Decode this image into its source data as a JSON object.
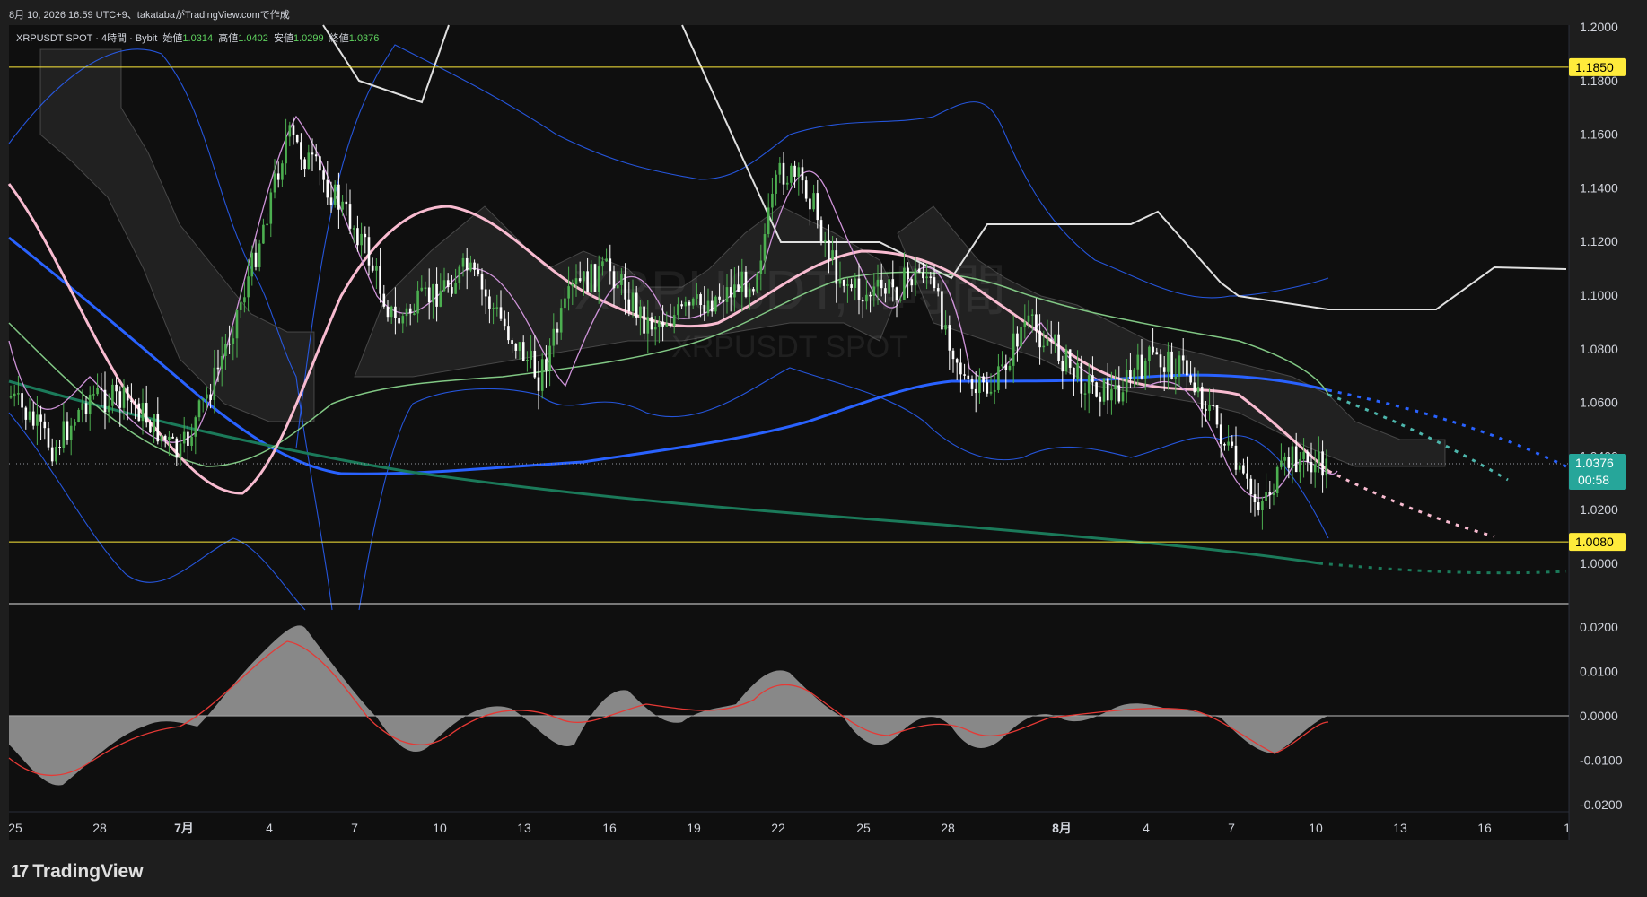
{
  "header": {
    "timestamp": "8月 10, 2026 16:59 UTC+9、takatabaがTradingView.comで作成"
  },
  "legend": {
    "symbol": "XRPUSDT SPOT · 4時間 · Bybit",
    "open_label": "始値",
    "open": "1.0314",
    "high_label": "高値",
    "high": "1.0402",
    "low_label": "安値",
    "low": "1.0299",
    "close_label": "終値",
    "close": "1.0376"
  },
  "watermark": {
    "line1": "XRPUSDT, 4時間",
    "line2": "XRPUSDT SPOT"
  },
  "colors": {
    "background": "#0f0f0f",
    "candle_up": "#4caf50",
    "candle_down": "#ffffff",
    "ma_pink": "#f8bbd0",
    "ma_blue": "#2962ff",
    "ma_green": "#1b7a5a",
    "level_yellow": "#ffeb3b",
    "price_tag": "#26a69a"
  },
  "price_axis": {
    "ticks": [
      "1.2000",
      "1.1800",
      "1.1600",
      "1.1400",
      "1.1200",
      "1.1000",
      "1.0800",
      "1.0600",
      "1.0400",
      "1.0200",
      "1.0000"
    ],
    "levels": [
      {
        "label": "1.1850",
        "value": 1.185
      },
      {
        "label": "1.0080",
        "value": 1.008
      }
    ],
    "current_price": "1.0376",
    "countdown": "00:58",
    "range": [
      0.985,
      1.2
    ]
  },
  "osc_axis": {
    "ticks": [
      "0.0200",
      "0.0100",
      "0.0000",
      "-0.0100",
      "-0.0200"
    ],
    "range": [
      -0.021,
      0.021
    ]
  },
  "time_axis": {
    "ticks": [
      "25",
      "28",
      "7月",
      "4",
      "7",
      "10",
      "13",
      "16",
      "19",
      "22",
      "25",
      "28",
      "8月",
      "4",
      "7",
      "10",
      "13",
      "16",
      "1"
    ]
  },
  "branding": {
    "logo_text": "TradingView",
    "logo_mark": "17"
  }
}
